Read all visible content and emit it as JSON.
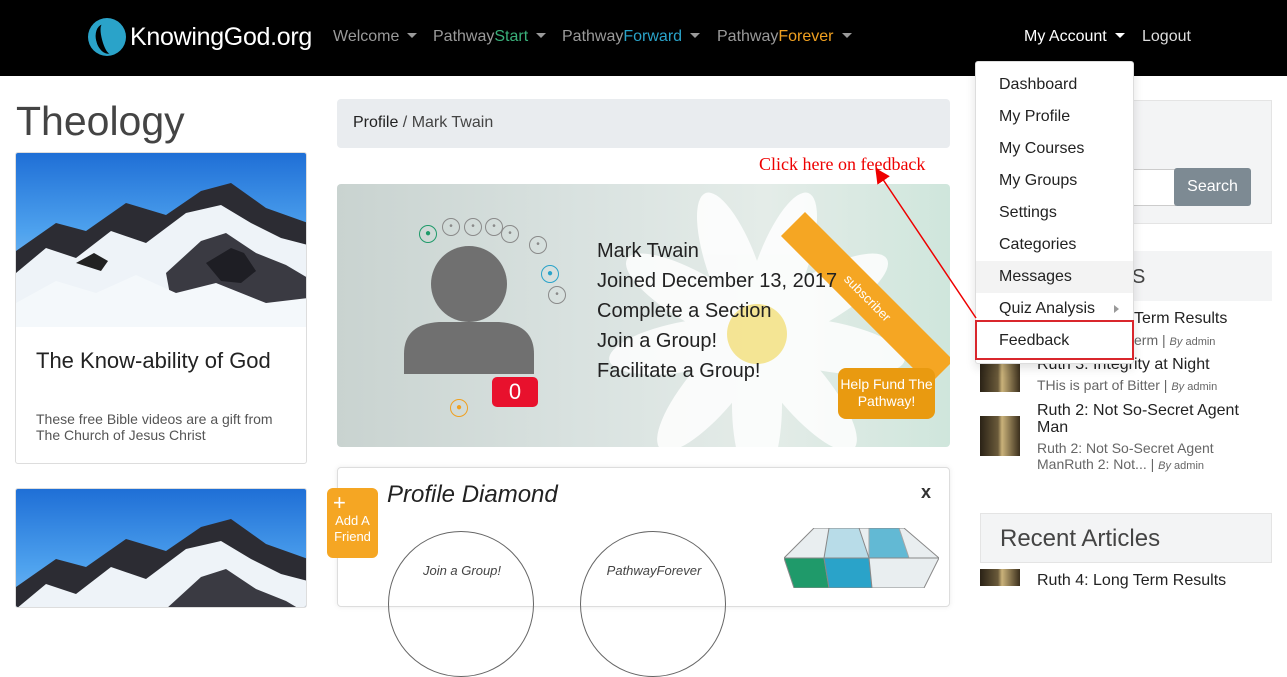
{
  "nav": {
    "brand": "KnowingGod.org",
    "welcome": "Welcome",
    "pathway_word": "Pathway",
    "start": "Start",
    "forward": "Forward",
    "forever": "Forever",
    "my_account": "My Account",
    "logout": "Logout"
  },
  "dropdown": {
    "items": [
      "Dashboard",
      "My Profile",
      "My Courses",
      "My Groups",
      "Settings",
      "Categories",
      "Messages",
      "Quiz Analysis",
      "Feedback"
    ],
    "highlighted": "Feedback"
  },
  "annotation": {
    "text": "Click here on feedback",
    "color": "#e00000"
  },
  "left": {
    "page_title": "Theology",
    "card": {
      "title": "The Know-ability of God",
      "desc": "These free Bible videos are a gift from The Church of Jesus Christ"
    }
  },
  "breadcrumb": {
    "link": "Profile",
    "separator": " / ",
    "current": "Mark Twain"
  },
  "profile": {
    "ribbon": "subscriber",
    "lines": [
      "Mark Twain",
      "Joined December 13, 2017",
      "Complete a Section",
      "Join a Group!",
      "Facilitate a Group!"
    ],
    "count": "0",
    "help_fund": "Help Fund The Pathway!"
  },
  "diamond": {
    "title": "Profile Diamond",
    "close": "x",
    "circles": [
      "Join a Group!",
      "PathwayForever"
    ],
    "add_friend": {
      "plus": "+",
      "label": "Add A Friend"
    }
  },
  "sidebar": {
    "search_button": "Search",
    "section_letter": "S",
    "articles": [
      {
        "title": "Term Results",
        "sub": "erm",
        "by": "By",
        "author": "admin"
      },
      {
        "title": "Ruth 3: Integrity at Night",
        "sub": "THis is part of Bitter",
        "by": "By",
        "author": "admin"
      },
      {
        "title": "Ruth 2: Not So-Secret Agent Man",
        "sub": "Ruth 2: Not So-Secret Agent ManRuth 2: Not...",
        "by": "By",
        "author": "admin"
      }
    ],
    "recent_title": "Recent Articles",
    "recent_first": "Ruth 4: Long Term Results"
  },
  "colors": {
    "navbar": "#000000",
    "start": "#3ab07a",
    "forward": "#2aa3c9",
    "forever": "#f0a020",
    "badge": "#e8112d",
    "highlight": "#d9262c"
  }
}
